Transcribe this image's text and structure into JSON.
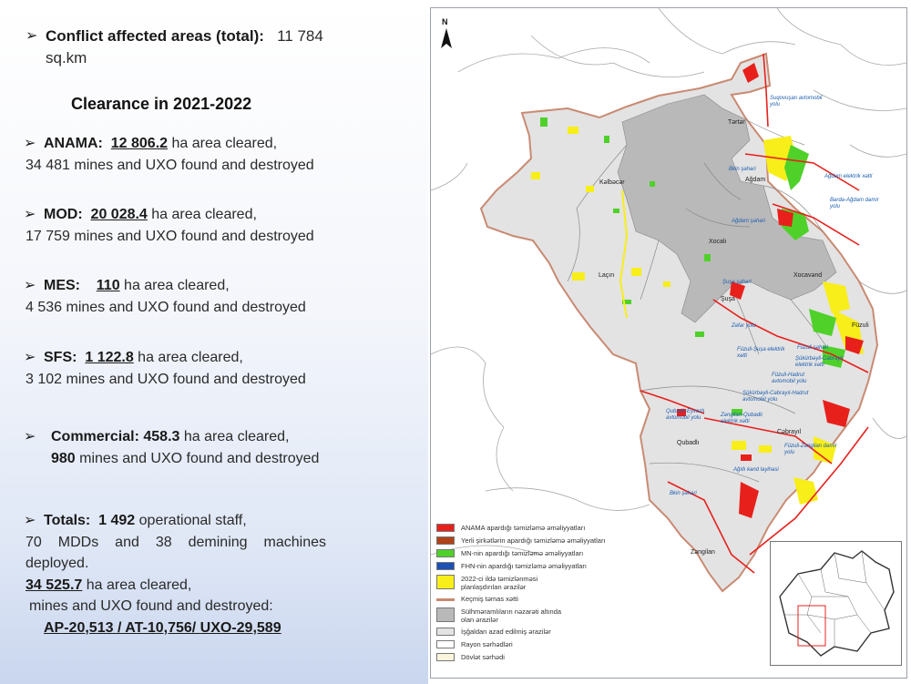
{
  "summary": {
    "title_label": "Conflict affected areas (total):",
    "title_value": "11 784",
    "title_unit": "sq.km",
    "heading": "Clearance in 2021-2022"
  },
  "items": [
    {
      "org": "ANAMA:",
      "area": "12 806.2",
      "area_text": " ha area cleared,",
      "rest": "34 481 mines and UXO found and destroyed"
    },
    {
      "org": "MOD:",
      "area": "20 028.4",
      "area_text": " ha area cleared,",
      "rest": "17 759 mines and UXO found and destroyed"
    },
    {
      "org": "MES:",
      "area": "110",
      "area_text": " ha area cleared,",
      "rest": "4 536 mines and UXO found and destroyed"
    },
    {
      "org": "SFS:",
      "area": "1 122.8",
      "area_text": " ha area cleared,",
      "rest": "3 102 mines and UXO found and destroyed"
    }
  ],
  "commercial": {
    "label": "Commercial:",
    "area": "458.3",
    "area_text": " ha area cleared,",
    "mines": "980",
    "mines_text": " mines and UXO found and destroyed"
  },
  "totals": {
    "label": "Totals:",
    "staff": "1 492",
    "staff_text": " operational staff,",
    "line2": "70 MDDs and 38 demining machines deployed.",
    "area": "34 525.7",
    "area_text": " ha area cleared,",
    "line4": "mines and UXO found and destroyed:",
    "breakdown": "AP-20,513 / AT-10,756/ UXO-29,589"
  },
  "map": {
    "north": "N",
    "districts": [
      "Tərtər",
      "Kəlbəcər",
      "Ağdam",
      "Xocalı",
      "Laçın",
      "Xocavənd",
      "Şuşa",
      "Füzuli",
      "Qubadlı",
      "Cəbrayıl",
      "Zəngilan"
    ],
    "route_labels": [
      "Suqovuşan avtomobil yolu",
      "Ağdam elektrik xətti",
      "Bərdə-Ağdam dəmir yolu",
      "Ağdam şəhəri",
      "Bkin şəhəri",
      "Şuşa şəhəri",
      "Zəfər yolu",
      "Füzuli-Şuşa elektrik xətti",
      "Füzuli şəhəri",
      "Şükürbəyli-Cəbrayıl elektrik xətti",
      "Füzuli-Hadrut avtomobil yolu",
      "Qubadlı-Eyvazlı avtomobil yolu",
      "Şükürbəyli-Cəbrayıl-Hadrut avtomobil yolu",
      "Zəngilan-Qubadlı elektrik xətti",
      "Füzuli-Zəngilan dəmir yolu",
      "Ağıllı kənd layihəsi",
      "Bkin şəhəri"
    ],
    "legend": [
      {
        "label": "ANAMA apardığı təmizləmə əməliyyatları",
        "color": "#e8201c"
      },
      {
        "label": "Yerli şirkətlərin apardığı təmizləmə əməliyyatları",
        "color": "#b0421a"
      },
      {
        "label": "MN-nin apardığı təmizləmə əməliyyatları",
        "color": "#4fd12a"
      },
      {
        "label": "FHN-nin apardığı təmizləmə əməliyyatları",
        "color": "#1d4fb5"
      },
      {
        "label": "2022-ci ildə təmizlənməsi planlaşdırılan ərazilər",
        "color": "#f7ee1a"
      },
      {
        "label": "Keçmiş təmas xətti",
        "color": "#c98a72"
      },
      {
        "label": "Sülhməramlıların nəzarəti altında olan ərazilər",
        "color": "#b9b9b9"
      },
      {
        "label": "İşğaldan azad edilmiş ərazilər",
        "color": "#e3e3e3"
      },
      {
        "label": "Rayon sərhədləri",
        "color": "#ffffff"
      },
      {
        "label": "Dövlət sərhədi",
        "color": "#fbf5dc"
      }
    ]
  }
}
